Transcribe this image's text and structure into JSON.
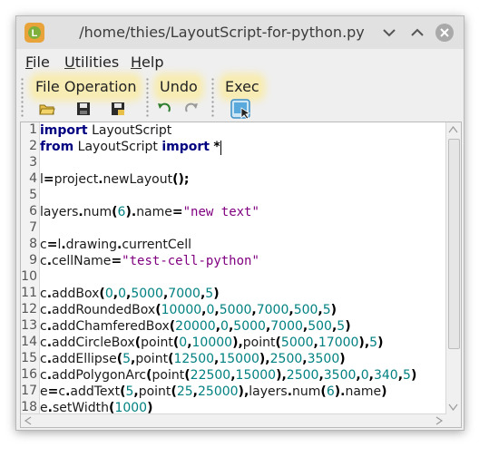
{
  "window": {
    "title": "/home/thies/LayoutScript-for-python.py",
    "buttons": [
      "chevron-down",
      "chevron-up",
      "close"
    ]
  },
  "menu": [
    {
      "underline": "F",
      "rest": "ile"
    },
    {
      "underline": "U",
      "rest": "tilities"
    },
    {
      "underline": "H",
      "rest": "elp"
    }
  ],
  "toolbar": {
    "groups": [
      {
        "label": "File Operation",
        "icons": [
          "open-folder-icon",
          "save-icon",
          "save-as-icon"
        ]
      },
      {
        "label": "Undo",
        "icons": [
          "undo-icon",
          "redo-icon"
        ]
      },
      {
        "label": "Exec",
        "icons": [
          "execute-icon"
        ]
      }
    ]
  },
  "colors": {
    "keyword": "#000080",
    "number": "#008080",
    "string": "#800080",
    "highlight": "#f7ecb4"
  },
  "editor": {
    "line_numbers": [
      "1",
      "2",
      "3",
      "4",
      "5",
      "6",
      "7",
      "8",
      "9",
      "10",
      "11",
      "12",
      "13",
      "14",
      "15",
      "16",
      "17",
      "18"
    ],
    "lines": [
      [
        [
          "kw",
          "import"
        ],
        [
          "t",
          " LayoutScript"
        ]
      ],
      [
        [
          "kw",
          "from"
        ],
        [
          "t",
          " LayoutScript "
        ],
        [
          "kw",
          "import"
        ],
        [
          "t",
          " "
        ],
        [
          "op",
          "*"
        ]
      ],
      [],
      [
        [
          "t",
          "l"
        ],
        [
          "op",
          "="
        ],
        [
          "t",
          "project"
        ],
        [
          "op",
          "."
        ],
        [
          "t",
          "newLayout"
        ],
        [
          "op",
          "();"
        ]
      ],
      [],
      [
        [
          "t",
          "layers"
        ],
        [
          "op",
          "."
        ],
        [
          "t",
          "num"
        ],
        [
          "op",
          "("
        ],
        [
          "num",
          "6"
        ],
        [
          "op",
          ")."
        ],
        [
          "t",
          "name"
        ],
        [
          "op",
          "="
        ],
        [
          "str",
          "\"new text\""
        ]
      ],
      [],
      [
        [
          "t",
          "c"
        ],
        [
          "op",
          "="
        ],
        [
          "t",
          "l"
        ],
        [
          "op",
          "."
        ],
        [
          "t",
          "drawing"
        ],
        [
          "op",
          "."
        ],
        [
          "t",
          "currentCell"
        ]
      ],
      [
        [
          "t",
          "c"
        ],
        [
          "op",
          "."
        ],
        [
          "t",
          "cellName"
        ],
        [
          "op",
          "="
        ],
        [
          "str",
          "\"test-cell-python\""
        ]
      ],
      [],
      [
        [
          "t",
          "c"
        ],
        [
          "op",
          "."
        ],
        [
          "t",
          "addBox"
        ],
        [
          "op",
          "("
        ],
        [
          "num",
          "0"
        ],
        [
          "op",
          ","
        ],
        [
          "num",
          "0"
        ],
        [
          "op",
          ","
        ],
        [
          "num",
          "5000"
        ],
        [
          "op",
          ","
        ],
        [
          "num",
          "7000"
        ],
        [
          "op",
          ","
        ],
        [
          "num",
          "5"
        ],
        [
          "op",
          ")"
        ]
      ],
      [
        [
          "t",
          "c"
        ],
        [
          "op",
          "."
        ],
        [
          "t",
          "addRoundedBox"
        ],
        [
          "op",
          "("
        ],
        [
          "num",
          "10000"
        ],
        [
          "op",
          ","
        ],
        [
          "num",
          "0"
        ],
        [
          "op",
          ","
        ],
        [
          "num",
          "5000"
        ],
        [
          "op",
          ","
        ],
        [
          "num",
          "7000"
        ],
        [
          "op",
          ","
        ],
        [
          "num",
          "500"
        ],
        [
          "op",
          ","
        ],
        [
          "num",
          "5"
        ],
        [
          "op",
          ")"
        ]
      ],
      [
        [
          "t",
          "c"
        ],
        [
          "op",
          "."
        ],
        [
          "t",
          "addChamferedBox"
        ],
        [
          "op",
          "("
        ],
        [
          "num",
          "20000"
        ],
        [
          "op",
          ","
        ],
        [
          "num",
          "0"
        ],
        [
          "op",
          ","
        ],
        [
          "num",
          "5000"
        ],
        [
          "op",
          ","
        ],
        [
          "num",
          "7000"
        ],
        [
          "op",
          ","
        ],
        [
          "num",
          "500"
        ],
        [
          "op",
          ","
        ],
        [
          "num",
          "5"
        ],
        [
          "op",
          ")"
        ]
      ],
      [
        [
          "t",
          "c"
        ],
        [
          "op",
          "."
        ],
        [
          "t",
          "addCircleBox"
        ],
        [
          "op",
          "("
        ],
        [
          "t",
          "point"
        ],
        [
          "op",
          "("
        ],
        [
          "num",
          "0"
        ],
        [
          "op",
          ","
        ],
        [
          "num",
          "10000"
        ],
        [
          "op",
          "),"
        ],
        [
          "t",
          "point"
        ],
        [
          "op",
          "("
        ],
        [
          "num",
          "5000"
        ],
        [
          "op",
          ","
        ],
        [
          "num",
          "17000"
        ],
        [
          "op",
          "),"
        ],
        [
          "num",
          "5"
        ],
        [
          "op",
          ")"
        ]
      ],
      [
        [
          "t",
          "c"
        ],
        [
          "op",
          "."
        ],
        [
          "t",
          "addEllipse"
        ],
        [
          "op",
          "("
        ],
        [
          "num",
          "5"
        ],
        [
          "op",
          ","
        ],
        [
          "t",
          "point"
        ],
        [
          "op",
          "("
        ],
        [
          "num",
          "12500"
        ],
        [
          "op",
          ","
        ],
        [
          "num",
          "15000"
        ],
        [
          "op",
          "),"
        ],
        [
          "num",
          "2500"
        ],
        [
          "op",
          ","
        ],
        [
          "num",
          "3500"
        ],
        [
          "op",
          ")"
        ]
      ],
      [
        [
          "t",
          "c"
        ],
        [
          "op",
          "."
        ],
        [
          "t",
          "addPolygonArc"
        ],
        [
          "op",
          "("
        ],
        [
          "t",
          "point"
        ],
        [
          "op",
          "("
        ],
        [
          "num",
          "22500"
        ],
        [
          "op",
          ","
        ],
        [
          "num",
          "15000"
        ],
        [
          "op",
          "),"
        ],
        [
          "num",
          "2500"
        ],
        [
          "op",
          ","
        ],
        [
          "num",
          "3500"
        ],
        [
          "op",
          ","
        ],
        [
          "num",
          "0"
        ],
        [
          "op",
          ","
        ],
        [
          "num",
          "340"
        ],
        [
          "op",
          ","
        ],
        [
          "num",
          "5"
        ],
        [
          "op",
          ")"
        ]
      ],
      [
        [
          "t",
          "e"
        ],
        [
          "op",
          "="
        ],
        [
          "t",
          "c"
        ],
        [
          "op",
          "."
        ],
        [
          "t",
          "addText"
        ],
        [
          "op",
          "("
        ],
        [
          "num",
          "5"
        ],
        [
          "op",
          ","
        ],
        [
          "t",
          "point"
        ],
        [
          "op",
          "("
        ],
        [
          "num",
          "25"
        ],
        [
          "op",
          ","
        ],
        [
          "num",
          "25000"
        ],
        [
          "op",
          "),"
        ],
        [
          "t",
          "layers"
        ],
        [
          "op",
          "."
        ],
        [
          "t",
          "num"
        ],
        [
          "op",
          "("
        ],
        [
          "num",
          "6"
        ],
        [
          "op",
          ")."
        ],
        [
          "t",
          "name"
        ],
        [
          "op",
          ")"
        ]
      ],
      [
        [
          "t",
          "e"
        ],
        [
          "op",
          "."
        ],
        [
          "t",
          "setWidth"
        ],
        [
          "op",
          "("
        ],
        [
          "num",
          "1000"
        ],
        [
          "op",
          ")"
        ]
      ]
    ]
  }
}
